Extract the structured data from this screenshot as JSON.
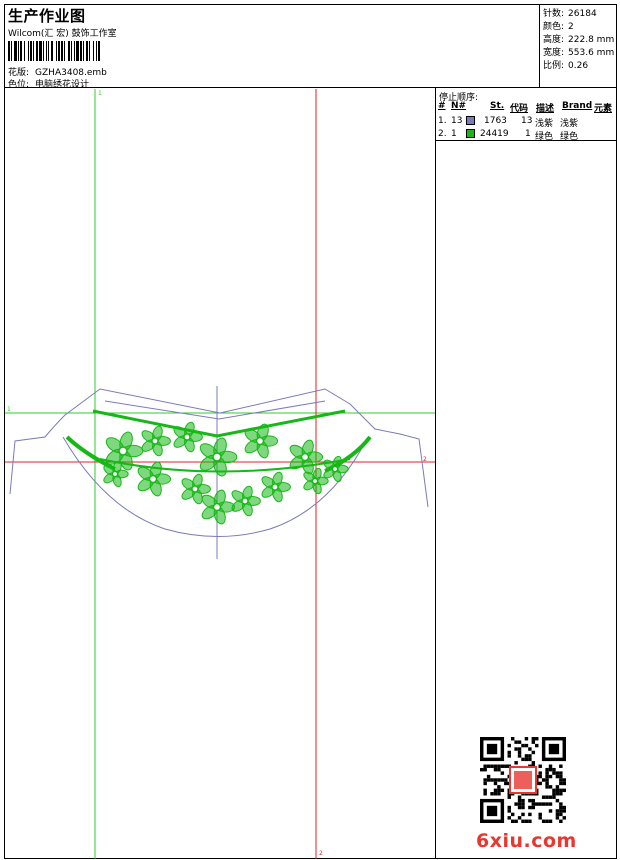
{
  "header": {
    "title": "生产作业图",
    "company": "Wilcom(汇 宏) 鼓饰工作室",
    "design_label": "花版:",
    "design_value": "GZHA3408.emb",
    "color_label": "色位:",
    "color_value": "电脑绣花设计"
  },
  "stats": [
    {
      "label": "针数:",
      "value": "26184"
    },
    {
      "label": "颜色:",
      "value": "2"
    },
    {
      "label": "高度:",
      "value": "222.8 mm"
    },
    {
      "label": "宽度:",
      "value": "553.6 mm"
    },
    {
      "label": "比例:",
      "value": "0.26"
    }
  ],
  "stop_sequence": {
    "title": "停止顺序:",
    "headers": {
      "num": "#",
      "n": "N#",
      "st": "St.",
      "code": "代码",
      "desc": "描述",
      "brand": "Brand",
      "element": "元素"
    },
    "rows": [
      {
        "num": "1.",
        "n": "13",
        "color": "#7b7bb8",
        "st": "1763",
        "code": "13",
        "desc": "浅紫",
        "brand": "浅紫"
      },
      {
        "num": "2.",
        "n": "1",
        "color": "#16b816",
        "st": "24419",
        "code": "1",
        "desc": "绿色",
        "brand": "绿色"
      }
    ]
  },
  "guides": {
    "top_mark": "1",
    "left_mark": "1",
    "right_mark": "2",
    "bottom_mark": "2"
  },
  "watermark": "6xiu.com",
  "colors": {
    "outline": "#7b7bb8",
    "embroidery": "#16b816",
    "guide_green": "#2ecc2e",
    "guide_red": "#e02020"
  }
}
